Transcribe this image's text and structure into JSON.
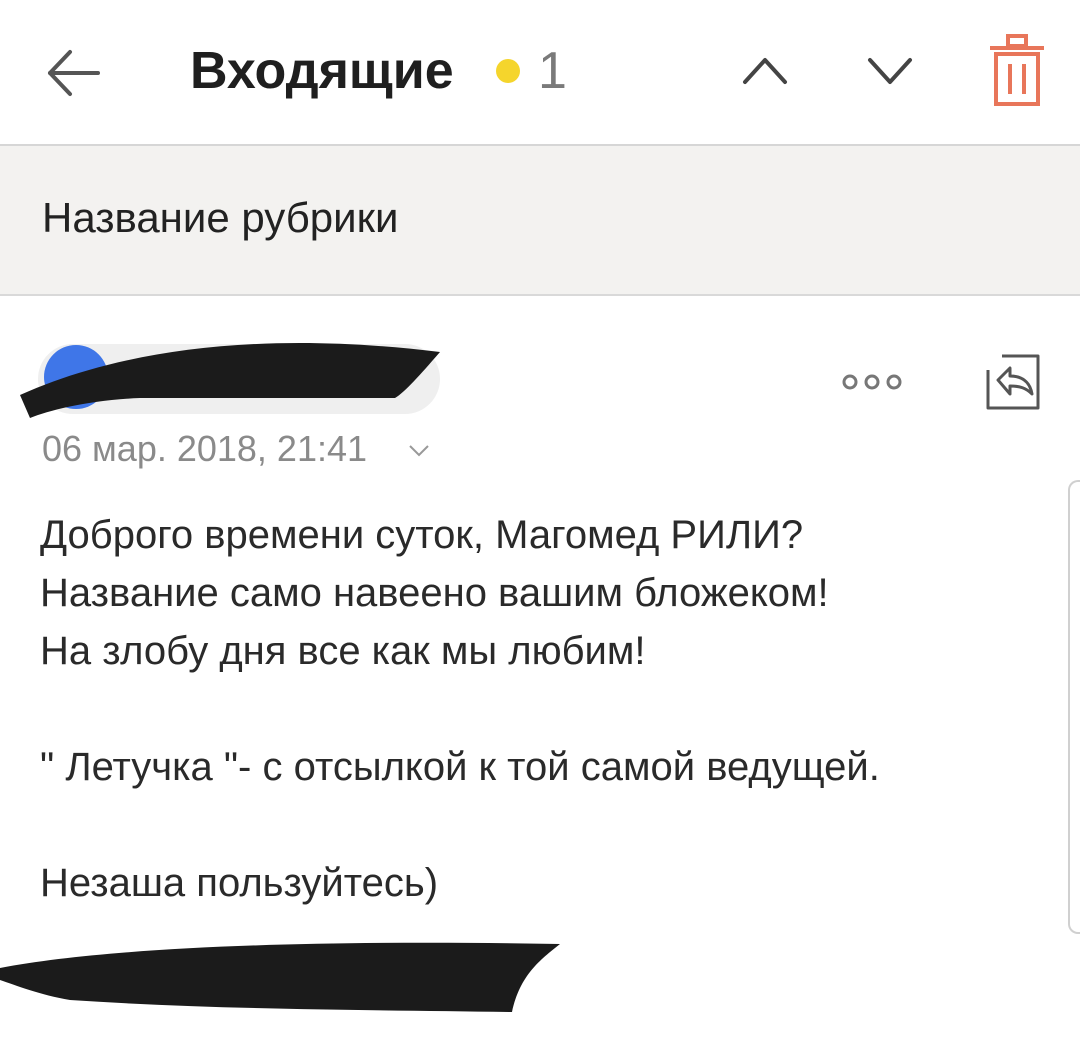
{
  "header": {
    "title": "Входящие",
    "unread_count": "1",
    "dot_color": "#f5d52c",
    "icons": [
      "arrow-left-icon",
      "chevron-up-icon",
      "chevron-down-icon",
      "trash-icon"
    ],
    "trash_color": "#e8765a"
  },
  "section": {
    "title": "Название рубрики"
  },
  "message": {
    "date": "06 мар. 2018, 21:41",
    "avatar_color": "#3f76e8",
    "body_lines": [
      "Доброго времени суток, Магомед РИЛИ?",
      "Название само навеено вашим бложеком!",
      "На злобу дня все как мы любим!",
      "\" Летучка \"- с отсылкой к той самой ведущей.",
      "Незаша пользуйтесь)"
    ],
    "icons": [
      "more-icon",
      "reply-icon"
    ]
  }
}
